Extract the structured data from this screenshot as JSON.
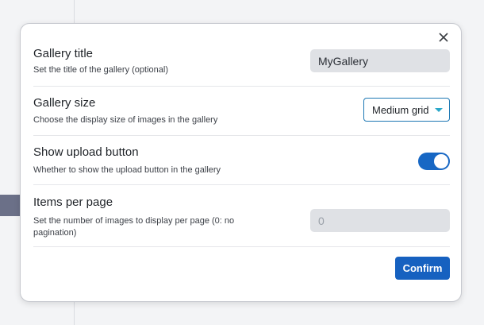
{
  "dialog": {
    "close_icon": "close-icon",
    "settings": [
      {
        "label": "Gallery title",
        "description": "Set the title of the gallery (optional)",
        "value": "MyGallery"
      },
      {
        "label": "Gallery size",
        "description": "Choose the display size of images in the gallery",
        "selected": "Medium grid",
        "caret_icon": "chevron-down-icon"
      },
      {
        "label": "Show upload button",
        "description": "Whether to show the upload button in the gallery",
        "toggle_on": true
      },
      {
        "label": "Items per page",
        "description": "Set the number of images to display per page (0: no pagination)",
        "placeholder": "0"
      }
    ],
    "confirm_label": "Confirm"
  },
  "colors": {
    "accent": "#1661c0",
    "toggle_on": "#1767c4",
    "select_border": "#1e78b4",
    "select_caret": "#2aa7c9",
    "input_bg": "#dfe1e5"
  }
}
